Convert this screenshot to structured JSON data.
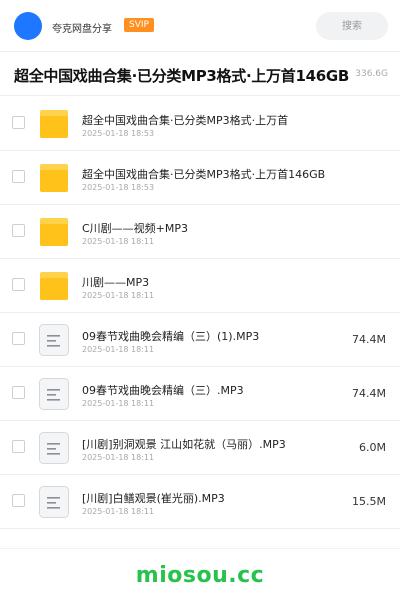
{
  "header": {
    "sharer_name": "夸克网盘分享",
    "badge": "SVIP",
    "search_placeholder": "搜索"
  },
  "share": {
    "title": "超全中国戏曲合集·已分类MP3格式·上万首146GB",
    "total_size": "336.6G"
  },
  "files": [
    {
      "type": "folder",
      "icon": "folder-icon",
      "name": "超全中国戏曲合集·已分类MP3格式·上万首",
      "date": "2025-01-18 18:53",
      "size": ""
    },
    {
      "type": "folder",
      "icon": "folder-icon",
      "name": "超全中国戏曲合集·已分类MP3格式·上万首146GB",
      "date": "2025-01-18 18:53",
      "size": ""
    },
    {
      "type": "folder",
      "icon": "folder-icon",
      "name": "C川剧——视频+MP3",
      "date": "2025-01-18 18:11",
      "size": ""
    },
    {
      "type": "folder",
      "icon": "folder-icon",
      "name": "川剧——MP3",
      "date": "2025-01-18 18:11",
      "size": ""
    },
    {
      "type": "file",
      "icon": "audio-file-icon",
      "name": "09春节戏曲晚会精编（三）(1).MP3",
      "date": "2025-01-18 18:11",
      "size": "74.4M"
    },
    {
      "type": "file",
      "icon": "audio-file-icon",
      "name": "09春节戏曲晚会精编（三）.MP3",
      "date": "2025-01-18 18:11",
      "size": "74.4M"
    },
    {
      "type": "file",
      "icon": "audio-file-icon",
      "name": "[川剧]别洞观景 江山如花就（马丽）.MP3",
      "date": "2025-01-18 18:11",
      "size": "6.0M"
    },
    {
      "type": "file",
      "icon": "audio-file-icon",
      "name": "[川剧]白鳝观景(崔光丽).MP3",
      "date": "2025-01-18 18:11",
      "size": "15.5M"
    }
  ],
  "footer": {
    "watermark": "miosou.cc"
  },
  "colors": {
    "accent_blue": "#1e78ff",
    "svip_orange": "#ff8f1f",
    "folder_yellow": "#ffc21a",
    "watermark_green": "#27c24c"
  }
}
